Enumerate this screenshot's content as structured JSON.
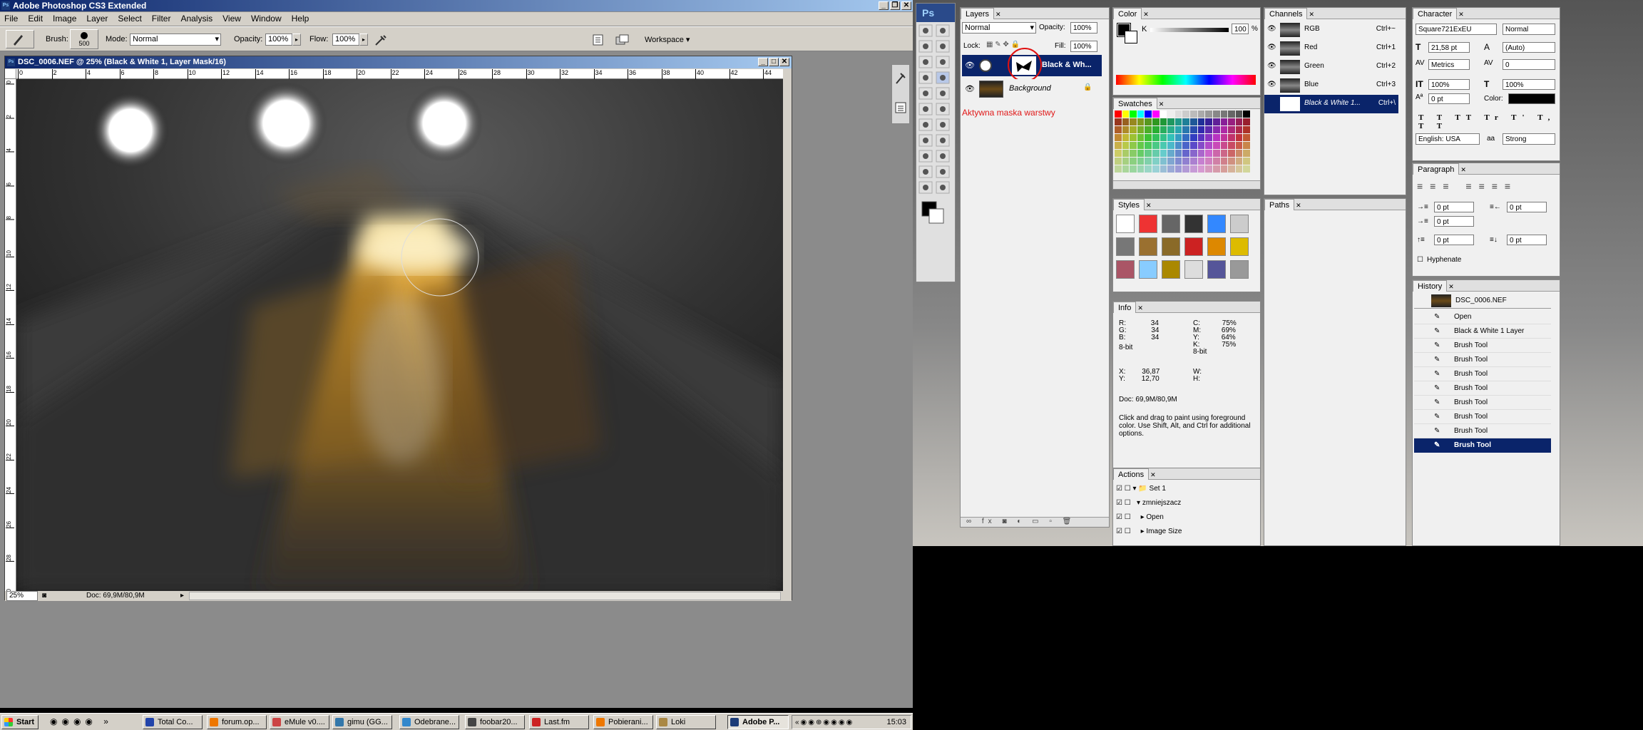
{
  "app": {
    "title": "Adobe Photoshop CS3 Extended",
    "logo": "Ps"
  },
  "menu": [
    "File",
    "Edit",
    "Image",
    "Layer",
    "Select",
    "Filter",
    "Analysis",
    "View",
    "Window",
    "Help"
  ],
  "options": {
    "brush_label": "Brush:",
    "brush_size": "500",
    "mode_label": "Mode:",
    "mode_value": "Normal",
    "opacity_label": "Opacity:",
    "opacity_value": "100%",
    "flow_label": "Flow:",
    "flow_value": "100%",
    "workspace": "Workspace ▾"
  },
  "document": {
    "title": "DSC_0006.NEF @ 25% (Black & White 1, Layer Mask/16)",
    "zoom": "25%",
    "doc_size": "Doc: 69,9M/80,9M",
    "ruler_top": [
      "0",
      "2",
      "4",
      "6",
      "8",
      "10",
      "12",
      "14",
      "16",
      "18",
      "20",
      "22",
      "24",
      "26",
      "28",
      "30",
      "32",
      "34",
      "36",
      "38",
      "40",
      "42",
      "44"
    ],
    "ruler_left": [
      "0",
      "2",
      "4",
      "6",
      "8",
      "10",
      "12",
      "14",
      "16",
      "18",
      "20",
      "22",
      "24",
      "26",
      "28",
      "30"
    ]
  },
  "layers": {
    "tab": "Layers",
    "blend": "Normal",
    "opacity_label": "Opacity:",
    "opacity": "100%",
    "lock_label": "Lock:",
    "fill_label": "Fill:",
    "fill": "100%",
    "items": [
      {
        "name": "Black & Wh..."
      },
      {
        "name": "Background"
      }
    ],
    "annotation": "Aktywna maska warstwy"
  },
  "color": {
    "tab": "Color",
    "k_label": "K",
    "k_value": "100",
    "unit": "%"
  },
  "swatches": {
    "tab": "Swatches"
  },
  "styles": {
    "tab": "Styles"
  },
  "info": {
    "tab": "Info",
    "r": "34",
    "g": "34",
    "b": "34",
    "c": "75%",
    "m": "69%",
    "y": "64%",
    "k": "75%",
    "bit1": "8-bit",
    "bit2": "8-bit",
    "x": "36,87",
    "yv": "12,70",
    "w": "",
    "h": "",
    "doc": "Doc: 69,9M/80,9M",
    "hint": "Click and drag to paint using foreground color. Use Shift, Alt, and Ctrl for additional options."
  },
  "actions": {
    "tab": "Actions",
    "items": [
      "Set 1",
      "zmniejszacz",
      "Open",
      "Image Size"
    ]
  },
  "channels": {
    "tab": "Channels",
    "items": [
      {
        "name": "RGB",
        "key": "Ctrl+~"
      },
      {
        "name": "Red",
        "key": "Ctrl+1"
      },
      {
        "name": "Green",
        "key": "Ctrl+2"
      },
      {
        "name": "Blue",
        "key": "Ctrl+3"
      },
      {
        "name": "Black & White 1...",
        "key": "Ctrl+\\"
      }
    ]
  },
  "paths": {
    "tab": "Paths"
  },
  "character": {
    "tab": "Character",
    "font": "Square721ExEU",
    "style": "Normal",
    "size": "21,58 pt",
    "leading": "(Auto)",
    "kerning": "Metrics",
    "tracking": "0",
    "vscale": "100%",
    "hscale": "100%",
    "baseline": "0 pt",
    "color_label": "Color:",
    "language": "English: USA",
    "aa_label": "aa",
    "aa": "Strong"
  },
  "paragraph": {
    "tab": "Paragraph",
    "indent_left": "0 pt",
    "indent_right": "0 pt",
    "indent_first": "0 pt",
    "space_before": "0 pt",
    "space_after": "0 pt",
    "hyphenate": "Hyphenate"
  },
  "history": {
    "tab": "History",
    "snapshot": "DSC_0006.NEF",
    "items": [
      "Open",
      "Black & White 1 Layer",
      "Brush Tool",
      "Brush Tool",
      "Brush Tool",
      "Brush Tool",
      "Brush Tool",
      "Brush Tool",
      "Brush Tool",
      "Brush Tool"
    ]
  },
  "taskbar": {
    "start": "Start",
    "items": [
      "Total Co...",
      "forum.op...",
      "eMule v0....",
      "gimu (GG...",
      "Odebrane...",
      "foobar20...",
      "Last.fm",
      "Pobierani...",
      "Loki",
      "Adobe P..."
    ],
    "clock": "15:03"
  }
}
